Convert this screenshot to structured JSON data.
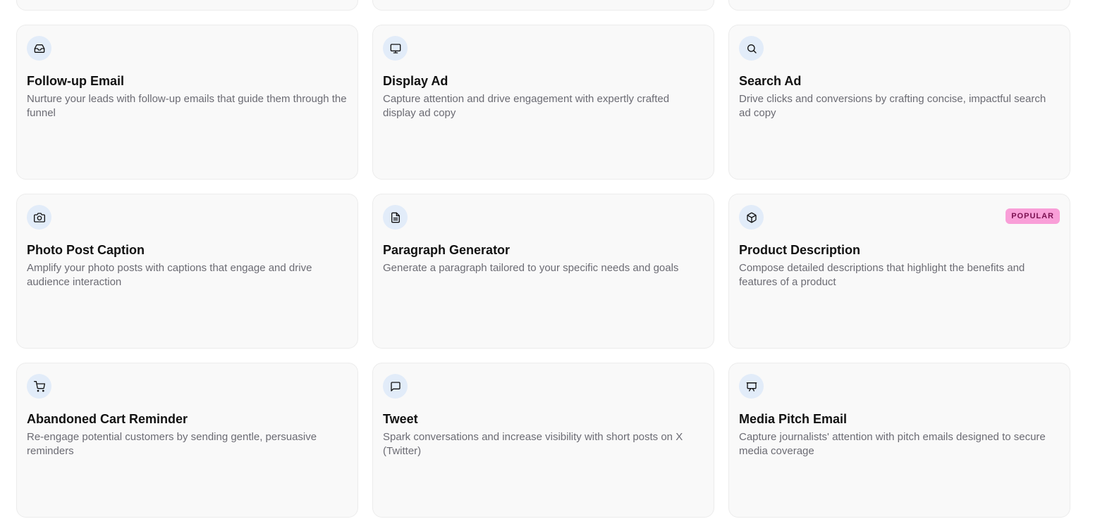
{
  "cards": [
    {
      "title": "",
      "description": "",
      "icon": "",
      "badge": ""
    },
    {
      "title": "",
      "description": "",
      "icon": "",
      "badge": ""
    },
    {
      "title": "",
      "description": "",
      "icon": "",
      "badge": ""
    },
    {
      "title": "Follow-up Email",
      "description": "Nurture your leads with follow-up emails that guide them through the funnel",
      "icon": "inbox-icon",
      "badge": ""
    },
    {
      "title": "Display Ad",
      "description": "Capture attention and drive engagement with expertly crafted display ad copy",
      "icon": "monitor-icon",
      "badge": ""
    },
    {
      "title": "Search Ad",
      "description": "Drive clicks and conversions by crafting concise, impactful search ad copy",
      "icon": "search-icon",
      "badge": ""
    },
    {
      "title": "Photo Post Caption",
      "description": "Amplify your photo posts with captions that engage and drive audience interaction",
      "icon": "camera-icon",
      "badge": ""
    },
    {
      "title": "Paragraph Generator",
      "description": "Generate a paragraph tailored to your specific needs and goals",
      "icon": "document-icon",
      "badge": ""
    },
    {
      "title": "Product Description",
      "description": "Compose detailed descriptions that highlight the benefits and features of a product",
      "icon": "box-icon",
      "badge": "POPULAR"
    },
    {
      "title": "Abandoned Cart Reminder",
      "description": "Re-engage potential customers by sending gentle, persuasive reminders",
      "icon": "cart-icon",
      "badge": ""
    },
    {
      "title": "Tweet",
      "description": "Spark conversations and increase visibility with short posts on X (Twitter)",
      "icon": "message-icon",
      "badge": ""
    },
    {
      "title": "Media Pitch Email",
      "description": "Capture journalists' attention with pitch emails designed to secure media coverage",
      "icon": "presentation-icon",
      "badge": ""
    }
  ],
  "colors": {
    "card_background": "#f9f9f9",
    "icon_background": "#e2ecf9",
    "badge_background": "#f99fd8",
    "title_color": "#111111",
    "description_color": "#6b6b73"
  }
}
